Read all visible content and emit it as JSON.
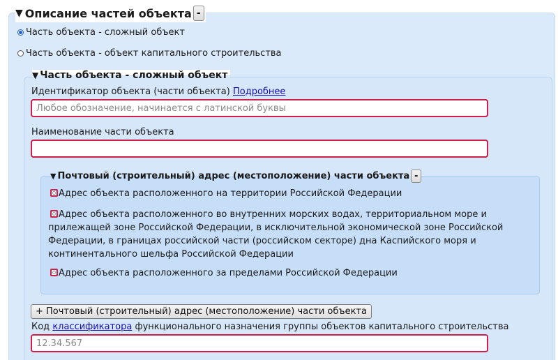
{
  "section": {
    "title": "Описание частей объекта",
    "collapse_label": "-"
  },
  "radio_options": [
    {
      "label": "Часть объекта - сложный объект",
      "checked": true
    },
    {
      "label": "Часть объекта - объект капитального строительства",
      "checked": false
    }
  ],
  "part": {
    "title": "Часть объекта - сложный объект",
    "identifier": {
      "label": "Идентификатор объекта (части объекта)",
      "link": "Подробнее",
      "value": "",
      "placeholder": "Любое обозначение, начинается с латинской буквы"
    },
    "name": {
      "label": "Наименование части объекта",
      "value": "",
      "placeholder": ""
    },
    "address": {
      "title": "Почтовый (строительный) адрес (местоположение) части объекта",
      "collapse_label": "-",
      "options": [
        "Адрес объекта расположенного на территории Российской Федерации",
        "Адрес объекта расположенного во внутренних морских водах, территориальном море и прилежащей зоне Российской Федерации, в исключительной экономической зоне Российской Федерации, в границах российской части (российском секторе) дна Каспийского моря и континентального шельфа Российской Федерации",
        "Адрес объекта расположенного за пределами Российской Федерации"
      ]
    },
    "add_address_button": "+ Почтовый (строительный) адрес (местоположение) части объекта",
    "classifier": {
      "label_prefix": "Код",
      "link": "классификатора",
      "label_suffix": "функционального назначения группы объектов капитального строительства",
      "value": "",
      "placeholder": "12.34.567"
    }
  },
  "colors": {
    "outer_panel": "#dbeafa",
    "inner_panel": "#d6e7fa",
    "address_panel": "#c6def8",
    "invalid_border": "#cc1f4a",
    "link": "#1a0dab"
  }
}
